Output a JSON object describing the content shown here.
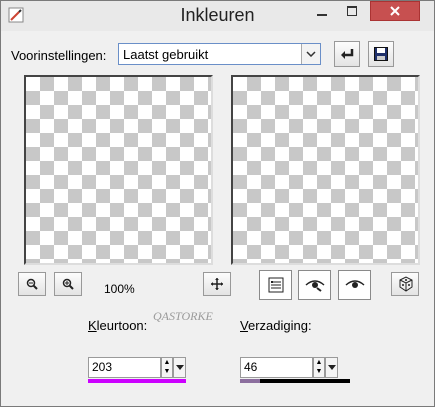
{
  "window": {
    "title": "Inkleuren"
  },
  "presets": {
    "label": "Voorinstellingen:",
    "selected": "Laatst gebruikt"
  },
  "zoom": {
    "level": "100%"
  },
  "hue": {
    "label": "Kleurtoon:",
    "value": "203",
    "bar_color": "#cc00ff"
  },
  "saturation": {
    "label": "Verzadiging:",
    "value": "46",
    "bar_color": "#8c6f9e",
    "fill_fraction": 0.18
  },
  "watermark": {
    "text": "QASTORKE"
  },
  "icons": {
    "app": "paintbrush-icon",
    "minimize": "minimize-icon",
    "maximize": "maximize-icon",
    "close": "close-icon",
    "reset": "undo-icon",
    "save": "floppy-disk-icon",
    "zoom_out": "zoom-out-icon",
    "zoom_in": "zoom-in-icon",
    "pan": "move-icon",
    "proof": "checklist-icon",
    "preview_on": "eye-icon",
    "preview_off": "eye-icon",
    "randomize": "dice-icon"
  }
}
